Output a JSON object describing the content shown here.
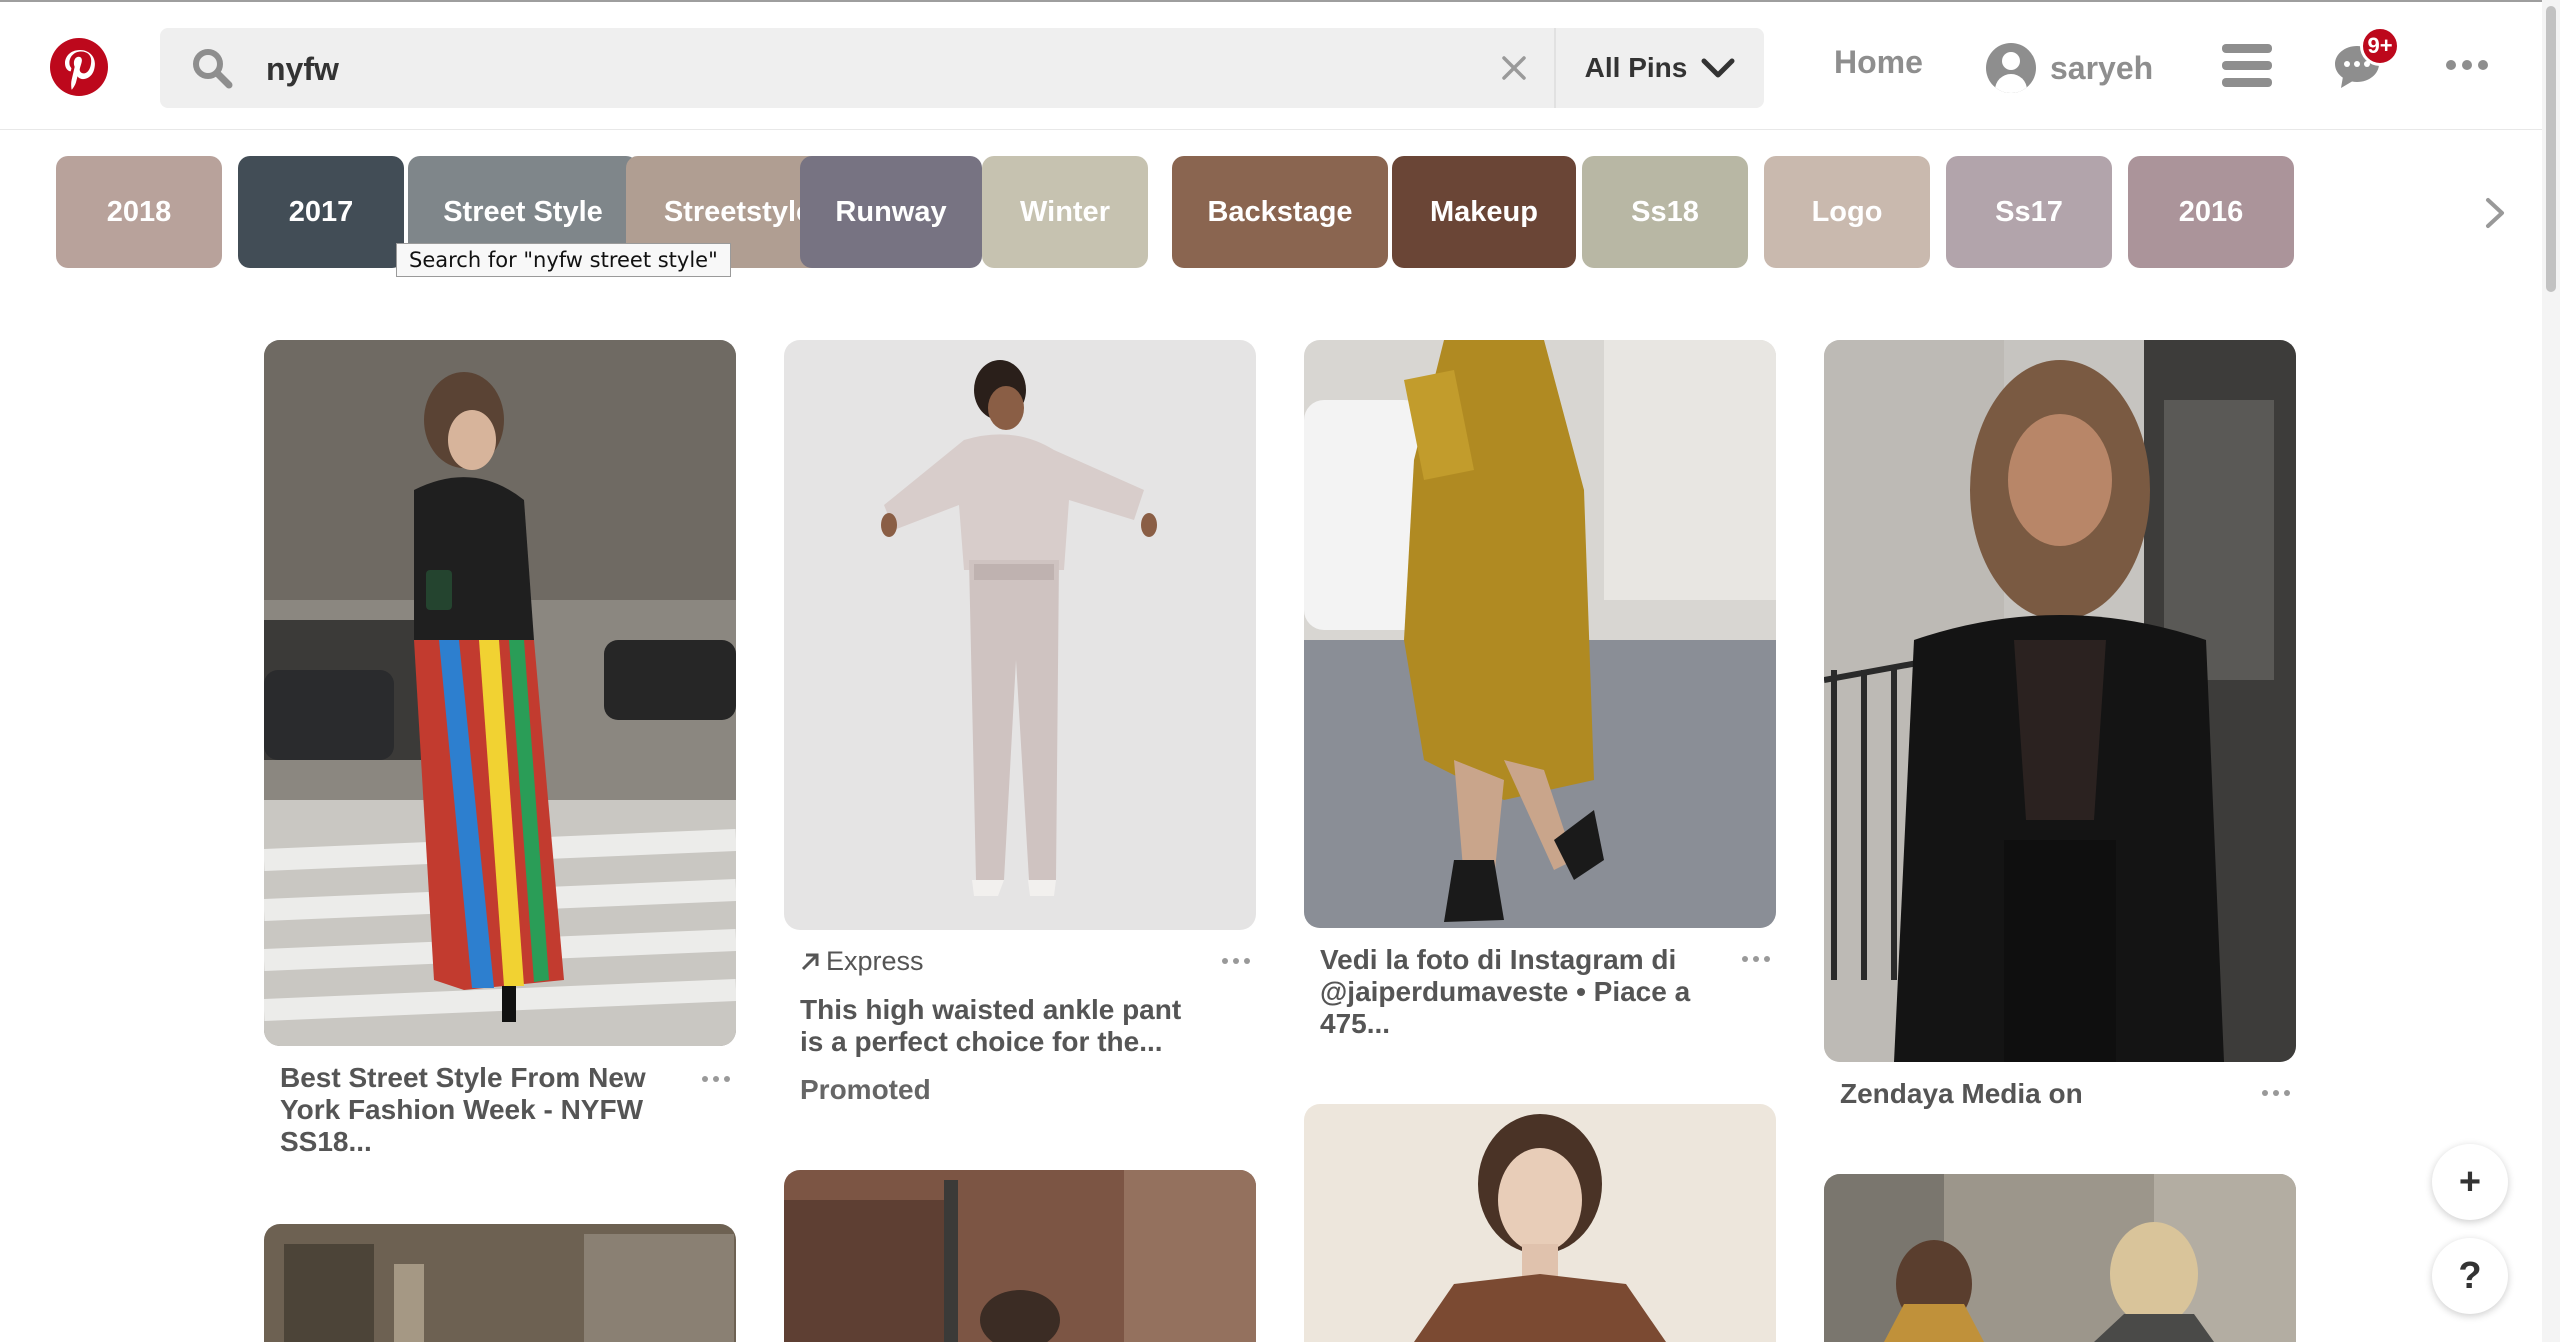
{
  "colors": {
    "brand": "#bd081c",
    "header_icon": "#8e8e8e",
    "search_bg": "#efefef"
  },
  "header": {
    "logo": "pinterest-logo",
    "search": {
      "value": "nyfw",
      "scope": "All Pins"
    },
    "nav": {
      "home": "Home",
      "username": "saryeh",
      "notification_count": "9+"
    }
  },
  "guides": {
    "chips": [
      {
        "label": "2018",
        "color": "#b8a29b"
      },
      {
        "label": "2017",
        "color": "#424d56"
      },
      {
        "label": "Street Style",
        "color": "#7f868a"
      },
      {
        "label": "Streetstyle",
        "color": "#b09e92"
      },
      {
        "label": "Runway",
        "color": "#777382"
      },
      {
        "label": "Winter",
        "color": "#c6c2b0"
      },
      {
        "label": "Backstage",
        "color": "#8a6550"
      },
      {
        "label": "Makeup",
        "color": "#6a4536"
      },
      {
        "label": "Ss18",
        "color": "#b8b7a4"
      },
      {
        "label": "Logo",
        "color": "#c9b9ae"
      },
      {
        "label": "Ss17",
        "color": "#b2a4ab"
      },
      {
        "label": "2016",
        "color": "#ab949a"
      }
    ],
    "tooltip": "Search for \"nyfw street style\""
  },
  "pins": [
    {
      "title_lines": [
        "Best Street Style From New",
        "York Fashion Week - NYFW",
        "SS18..."
      ]
    },
    {
      "source": "Express",
      "title_lines": [
        "This high waisted ankle pant",
        "is a perfect choice for the..."
      ],
      "promoted": "Promoted"
    },
    {
      "title_lines": [
        "Vedi la foto di Instagram di",
        "@jaiperdumaveste • Piace a",
        "475..."
      ]
    },
    {
      "title_lines": [
        "Zendaya Media on"
      ]
    }
  ],
  "floating": {
    "add": "+",
    "help": "?"
  }
}
